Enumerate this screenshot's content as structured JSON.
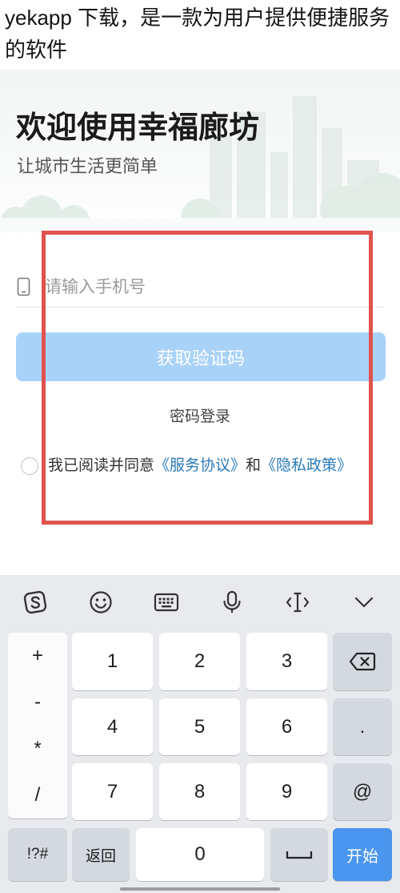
{
  "caption": "yekapp 下载，是一款为用户提供便捷服务的软件",
  "header": {
    "title": "欢迎使用幸福廊坊",
    "subtitle": "让城市生活更简单",
    "illustration": "city-skyline"
  },
  "login": {
    "phone_icon": "phone-icon",
    "phone_placeholder": "请输入手机号",
    "get_code_label": "获取验证码",
    "password_login_label": "密码登录",
    "agreement": {
      "checked": false,
      "prefix": "我已阅读并同意",
      "service_link": "《服务协议》",
      "and": "和",
      "privacy_link": "《隐私政策》"
    }
  },
  "keyboard": {
    "toolbar_icons": [
      "sogou-logo-icon",
      "emoji-icon",
      "keyboard-icon",
      "microphone-icon",
      "cursor-move-icon",
      "chevron-down-icon"
    ],
    "symbol_column": [
      "+",
      "-",
      "*",
      "/"
    ],
    "digits": [
      "1",
      "2",
      "3",
      "4",
      "5",
      "6",
      "7",
      "8",
      "9"
    ],
    "backspace_icon": "backspace-icon",
    "dot_key": ".",
    "at_key": "@",
    "bottom_row": {
      "symbols_key": "!?#",
      "back_key": "返回",
      "zero_key": "0",
      "space_icon": "space-icon",
      "enter_key": "开始"
    }
  },
  "colors": {
    "button_bg": "#a9d2f8",
    "link": "#2b7bb9",
    "enter_key": "#4a95ee",
    "highlight_frame": "#e1524e",
    "keyboard_bg": "#e8eaee"
  }
}
